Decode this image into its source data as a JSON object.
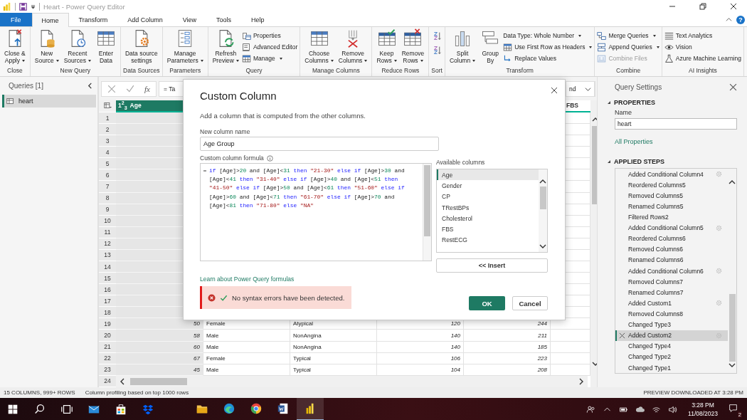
{
  "window": {
    "title": "Heart - Power Query Editor"
  },
  "ribbon_tabs": [
    {
      "label": "File",
      "kind": "file",
      "selected": false
    },
    {
      "label": "Home",
      "kind": "tab",
      "selected": true
    },
    {
      "label": "Transform",
      "kind": "tab",
      "selected": false
    },
    {
      "label": "Add Column",
      "kind": "tab",
      "selected": false
    },
    {
      "label": "View",
      "kind": "tab",
      "selected": false
    },
    {
      "label": "Tools",
      "kind": "tab",
      "selected": false
    },
    {
      "label": "Help",
      "kind": "tab",
      "selected": false
    }
  ],
  "help": {
    "label": "?"
  },
  "ribbon_groups": [
    {
      "label": "Close",
      "items": [
        {
          "kind": "large",
          "lines": [
            "Close &",
            "Apply"
          ],
          "dropdown": true,
          "disabled": false
        }
      ]
    },
    {
      "label": "New Query",
      "items": [
        {
          "kind": "large",
          "lines": [
            "New",
            "Source"
          ],
          "dropdown": true,
          "disabled": false
        },
        {
          "kind": "large",
          "lines": [
            "Recent",
            "Sources"
          ],
          "dropdown": true,
          "disabled": false
        },
        {
          "kind": "large",
          "lines": [
            "Enter",
            "Data"
          ],
          "dropdown": false,
          "disabled": false
        }
      ]
    },
    {
      "label": "Data Sources",
      "items": [
        {
          "kind": "large",
          "lines": [
            "Data source",
            "settings"
          ],
          "dropdown": false,
          "disabled": false
        }
      ]
    },
    {
      "label": "Parameters",
      "items": [
        {
          "kind": "large",
          "lines": [
            "Manage",
            "Parameters"
          ],
          "dropdown": true,
          "disabled": false
        }
      ]
    },
    {
      "label": "Query",
      "items": [
        {
          "kind": "large",
          "lines": [
            "Refresh",
            "Preview"
          ],
          "dropdown": true,
          "disabled": false
        },
        {
          "kind": "small",
          "label": "Properties",
          "dropdown": false,
          "disabled": false
        },
        {
          "kind": "small",
          "label": "Advanced Editor",
          "dropdown": false,
          "disabled": false
        },
        {
          "kind": "small",
          "label": "Manage",
          "dropdown": true,
          "disabled": false
        }
      ]
    },
    {
      "label": "Manage Columns",
      "items": [
        {
          "kind": "large",
          "lines": [
            "Choose",
            "Columns"
          ],
          "dropdown": true,
          "disabled": false
        },
        {
          "kind": "large",
          "lines": [
            "Remove",
            "Columns"
          ],
          "dropdown": true,
          "disabled": false
        }
      ]
    },
    {
      "label": "Reduce Rows",
      "items": [
        {
          "kind": "large",
          "lines": [
            "Keep",
            "Rows"
          ],
          "dropdown": true,
          "disabled": false
        },
        {
          "kind": "large",
          "lines": [
            "Remove",
            "Rows"
          ],
          "dropdown": true,
          "disabled": false
        }
      ]
    },
    {
      "label": "Sort",
      "items": [
        {
          "kind": "icon",
          "disabled": false
        },
        {
          "kind": "icon",
          "disabled": false
        }
      ]
    },
    {
      "label": "Transform",
      "items": [
        {
          "kind": "large",
          "lines": [
            "Split",
            "Column"
          ],
          "dropdown": true,
          "disabled": false
        },
        {
          "kind": "large",
          "lines": [
            "Group",
            "By"
          ],
          "dropdown": false,
          "disabled": false
        },
        {
          "kind": "small",
          "label": "Data Type: Whole Number",
          "dropdown": true,
          "disabled": false
        },
        {
          "kind": "small",
          "label": "Use First Row as Headers",
          "dropdown": true,
          "disabled": false
        },
        {
          "kind": "small",
          "label": "Replace Values",
          "dropdown": false,
          "disabled": false
        }
      ]
    },
    {
      "label": "Combine",
      "items": [
        {
          "kind": "small",
          "label": "Merge Queries",
          "dropdown": true,
          "disabled": false
        },
        {
          "kind": "small",
          "label": "Append Queries",
          "dropdown": true,
          "disabled": false
        },
        {
          "kind": "small",
          "label": "Combine Files",
          "dropdown": false,
          "disabled": true
        }
      ]
    },
    {
      "label": "AI Insights",
      "items": [
        {
          "kind": "small",
          "label": "Text Analytics",
          "dropdown": false,
          "disabled": false
        },
        {
          "kind": "small",
          "label": "Vision",
          "dropdown": false,
          "disabled": false
        },
        {
          "kind": "small",
          "label": "Azure Machine Learning",
          "dropdown": false,
          "disabled": false
        }
      ]
    }
  ],
  "queries_panel": {
    "title": "Queries [1]",
    "items": [
      {
        "label": "heart",
        "selected": true
      }
    ]
  },
  "formula_bar": {
    "fx": "fx",
    "value": "= Ta",
    "step_dropdown": "nd"
  },
  "table": {
    "columns": [
      {
        "label": "Age",
        "type_label": "1$^{2}$$_{3}$",
        "kind": "number",
        "selected": true
      },
      {
        "kind": "text",
        "selected": false
      },
      {
        "kind": "text",
        "selected": false
      },
      {
        "kind": "number",
        "selected": false
      },
      {
        "kind": "number",
        "selected": false
      },
      {
        "label": "FBS",
        "selected": false
      }
    ],
    "rows": [
      {
        "number": "1"
      },
      {
        "number": "2"
      },
      {
        "number": "3"
      },
      {
        "number": "4"
      },
      {
        "number": "5"
      },
      {
        "number": "6"
      },
      {
        "number": "7"
      },
      {
        "number": "8"
      },
      {
        "number": "9"
      },
      {
        "number": "10"
      },
      {
        "number": "11"
      },
      {
        "number": "12"
      },
      {
        "number": "13"
      },
      {
        "number": "14"
      },
      {
        "number": "15"
      },
      {
        "number": "16"
      },
      {
        "number": "17"
      },
      {
        "number": "18"
      },
      {
        "number": "19",
        "cells": [
          "50",
          "Female",
          "Atypical",
          "120",
          "244"
        ]
      },
      {
        "number": "20",
        "cells": [
          "58",
          "Male",
          "NonAngina",
          "140",
          "211"
        ]
      },
      {
        "number": "21",
        "cells": [
          "60",
          "Male",
          "NonAngina",
          "140",
          "185"
        ]
      },
      {
        "number": "22",
        "cells": [
          "67",
          "Female",
          "Typical",
          "106",
          "223"
        ]
      },
      {
        "number": "23",
        "cells": [
          "45",
          "Male",
          "Typical",
          "104",
          "208"
        ]
      }
    ],
    "scroll_row_number": "24"
  },
  "dialog": {
    "title": "Custom Column",
    "description": "Add a column that is computed from the other columns.",
    "name_label": "New column name",
    "name_value": "Age Group",
    "formula_label": "Custom column formula",
    "formula_lines": [
      [
        {
          "kind": "keyword",
          "text": "if"
        },
        {
          "kind": "plain",
          "text": " [Age]>"
        },
        {
          "kind": "number",
          "text": "20"
        },
        {
          "kind": "plain",
          "text": " and [Age]<"
        },
        {
          "kind": "number",
          "text": "31"
        },
        {
          "kind": "keyword",
          "text": " then"
        },
        {
          "kind": "string",
          "text": " \"21-30\""
        },
        {
          "kind": "keyword",
          "text": " else if"
        },
        {
          "kind": "plain",
          "text": " [Age]>"
        },
        {
          "kind": "number",
          "text": "30"
        },
        {
          "kind": "plain",
          "text": " and"
        }
      ],
      [
        {
          "kind": "plain",
          "text": "[Age]<"
        },
        {
          "kind": "number",
          "text": "41"
        },
        {
          "kind": "keyword",
          "text": " then"
        },
        {
          "kind": "string",
          "text": " \"31-40\""
        },
        {
          "kind": "keyword",
          "text": " else if"
        },
        {
          "kind": "plain",
          "text": " [Age]>"
        },
        {
          "kind": "number",
          "text": "40"
        },
        {
          "kind": "plain",
          "text": " and [Age]<"
        },
        {
          "kind": "number",
          "text": "51"
        },
        {
          "kind": "keyword",
          "text": " then"
        }
      ],
      [
        {
          "kind": "string",
          "text": "\"41-50\""
        },
        {
          "kind": "keyword",
          "text": " else if"
        },
        {
          "kind": "plain",
          "text": " [Age]>"
        },
        {
          "kind": "number",
          "text": "50"
        },
        {
          "kind": "plain",
          "text": " and [Age]<"
        },
        {
          "kind": "number",
          "text": "61"
        },
        {
          "kind": "keyword",
          "text": " then"
        },
        {
          "kind": "string",
          "text": " \"51-60\""
        },
        {
          "kind": "keyword",
          "text": " else if"
        }
      ],
      [
        {
          "kind": "plain",
          "text": "[Age]>"
        },
        {
          "kind": "number",
          "text": "60"
        },
        {
          "kind": "plain",
          "text": " and [Age]<"
        },
        {
          "kind": "number",
          "text": "71"
        },
        {
          "kind": "keyword",
          "text": " then"
        },
        {
          "kind": "string",
          "text": " \"61-70\""
        },
        {
          "kind": "keyword",
          "text": " else if"
        },
        {
          "kind": "plain",
          "text": " [Age]>"
        },
        {
          "kind": "number",
          "text": "70"
        },
        {
          "kind": "plain",
          "text": " and"
        }
      ],
      [
        {
          "kind": "plain",
          "text": "[Age]<"
        },
        {
          "kind": "number",
          "text": "81"
        },
        {
          "kind": "keyword",
          "text": " then"
        },
        {
          "kind": "string",
          "text": " \"71-80\""
        },
        {
          "kind": "keyword",
          "text": " else"
        },
        {
          "kind": "string",
          "text": " \"NA\""
        }
      ]
    ],
    "columns_label": "Available columns",
    "columns": [
      {
        "label": "Age",
        "selected": true
      },
      {
        "label": "Gender",
        "selected": false
      },
      {
        "label": "CP",
        "selected": false
      },
      {
        "label": "TRestBPs",
        "selected": false
      },
      {
        "label": "Cholesterol",
        "selected": false
      },
      {
        "label": "FBS",
        "selected": false
      },
      {
        "label": "RestECG",
        "selected": false
      }
    ],
    "insert_button": "<< Insert",
    "learn_link": "Learn about Power Query formulas",
    "status": {
      "kind": "error",
      "text": "No syntax errors have been detected."
    },
    "ok_button": "OK",
    "cancel_button": "Cancel"
  },
  "query_settings": {
    "title": "Query Settings",
    "properties_heading": "PROPERTIES",
    "name_label": "Name",
    "name_value": "heart",
    "all_properties_link": "All Properties",
    "steps_heading": "APPLIED STEPS",
    "steps": [
      {
        "label": "Added Conditional Column4",
        "has_settings": true,
        "selected": false
      },
      {
        "label": "Reordered Columns5",
        "has_settings": false,
        "selected": false
      },
      {
        "label": "Removed Columns5",
        "has_settings": false,
        "selected": false
      },
      {
        "label": "Renamed Columns5",
        "has_settings": false,
        "selected": false
      },
      {
        "label": "Filtered Rows2",
        "has_settings": false,
        "selected": false
      },
      {
        "label": "Added Conditional Column5",
        "has_settings": true,
        "selected": false
      },
      {
        "label": "Reordered Columns6",
        "has_settings": false,
        "selected": false
      },
      {
        "label": "Removed Columns6",
        "has_settings": false,
        "selected": false
      },
      {
        "label": "Renamed Columns6",
        "has_settings": false,
        "selected": false
      },
      {
        "label": "Added Conditional Column6",
        "has_settings": true,
        "selected": false
      },
      {
        "label": "Removed Columns7",
        "has_settings": false,
        "selected": false
      },
      {
        "label": "Renamed Columns7",
        "has_settings": false,
        "selected": false
      },
      {
        "label": "Added Custom1",
        "has_settings": true,
        "selected": false
      },
      {
        "label": "Removed Columns8",
        "has_settings": false,
        "selected": false
      },
      {
        "label": "Changed Type3",
        "has_settings": false,
        "selected": false
      },
      {
        "label": "Added Custom2",
        "has_settings": true,
        "selected": true
      },
      {
        "label": "Changed Type4",
        "has_settings": false,
        "selected": false
      },
      {
        "label": "Changed Type2",
        "has_settings": false,
        "selected": false
      },
      {
        "label": "Changed Type1",
        "has_settings": false,
        "selected": false
      }
    ]
  },
  "status_bar": {
    "counts": "15 COLUMNS, 999+ ROWS",
    "profiling": "Column profiling based on top 1000 rows",
    "preview": "PREVIEW DOWNLOADED AT 3:28 PM"
  },
  "taskbar": {
    "apps": [
      {
        "kind": "folder",
        "active": false
      },
      {
        "kind": "wave",
        "active": false
      },
      {
        "kind": "ring",
        "active": false
      },
      {
        "kind": "document",
        "active": false
      },
      {
        "kind": "bars",
        "active": true
      }
    ],
    "pinned_left": [
      {
        "kind": "mail"
      },
      {
        "kind": "bag"
      },
      {
        "kind": "boxes"
      }
    ],
    "time": "3:28 PM",
    "date": "11/08/2023",
    "notifications": "2"
  }
}
